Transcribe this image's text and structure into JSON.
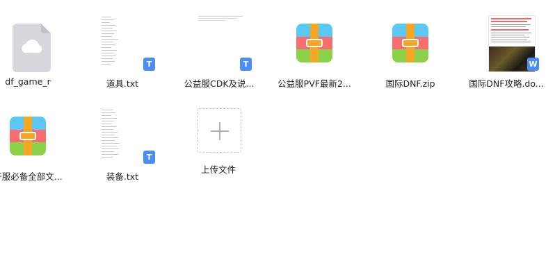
{
  "files": [
    {
      "name": "df_game_r",
      "type": "cloud-file-icon"
    },
    {
      "name": "道具.txt",
      "type": "txt-file-icon",
      "badge": "T"
    },
    {
      "name": "公益服CDK及说...",
      "type": "txt-file-icon",
      "badge": "T"
    },
    {
      "name": "公益服PVF最新2...",
      "type": "archive-icon"
    },
    {
      "name": "国际DNF.zip",
      "type": "archive-icon"
    },
    {
      "name": "国际DNF攻略.do...",
      "type": "doc-file-icon",
      "badge": "W"
    },
    {
      "name": "开服必备全部文...",
      "type": "archive-icon"
    },
    {
      "name": "装备.txt",
      "type": "txt-file-icon",
      "badge": "T"
    }
  ],
  "upload": {
    "label": "上传文件",
    "icon": "plus-icon"
  },
  "colors": {
    "accent": "#4a8df8",
    "zip_blue": "#5bc8f4",
    "zip_red": "#f76e6e",
    "zip_green": "#8bd24a",
    "zip_strap": "#f5a623"
  }
}
